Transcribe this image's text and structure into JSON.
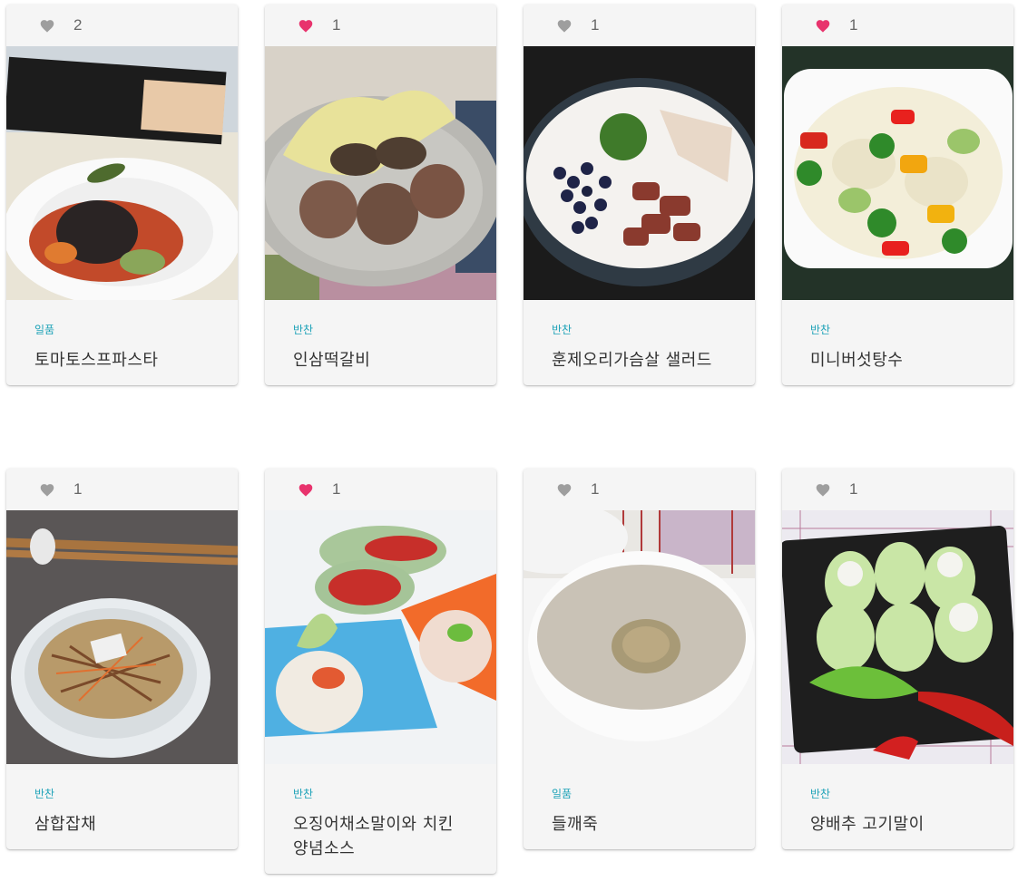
{
  "colors": {
    "heart_liked": "#e8336d",
    "heart_unliked": "#9e9e9e",
    "category": "#1fa3b8",
    "card_bg": "#f5f5f5"
  },
  "recipes": [
    {
      "likes": "2",
      "liked": false,
      "category": "일품",
      "title": "토마토스프파스타",
      "photo": "tomato-soup-pasta-photo"
    },
    {
      "likes": "1",
      "liked": true,
      "category": "반찬",
      "title": "인삼떡갈비",
      "photo": "ginseng-tteokgalbi-photo"
    },
    {
      "likes": "1",
      "liked": false,
      "category": "반찬",
      "title": "훈제오리가슴살 샐러드",
      "photo": "smoked-duck-salad-photo"
    },
    {
      "likes": "1",
      "liked": true,
      "category": "반찬",
      "title": "미니버섯탕수",
      "photo": "mini-mushroom-tangsu-photo"
    },
    {
      "likes": "1",
      "liked": false,
      "category": "반찬",
      "title": "삼합잡채",
      "photo": "samhap-japchae-photo"
    },
    {
      "likes": "1",
      "liked": true,
      "category": "반찬",
      "title": "오징어채소말이와 치킨 양념소스",
      "photo": "squid-vegetable-roll-photo"
    },
    {
      "likes": "1",
      "liked": false,
      "category": "일품",
      "title": "들깨죽",
      "photo": "perilla-porridge-photo"
    },
    {
      "likes": "1",
      "liked": false,
      "category": "반찬",
      "title": "양배추 고기말이",
      "photo": "cabbage-meat-roll-photo"
    }
  ]
}
